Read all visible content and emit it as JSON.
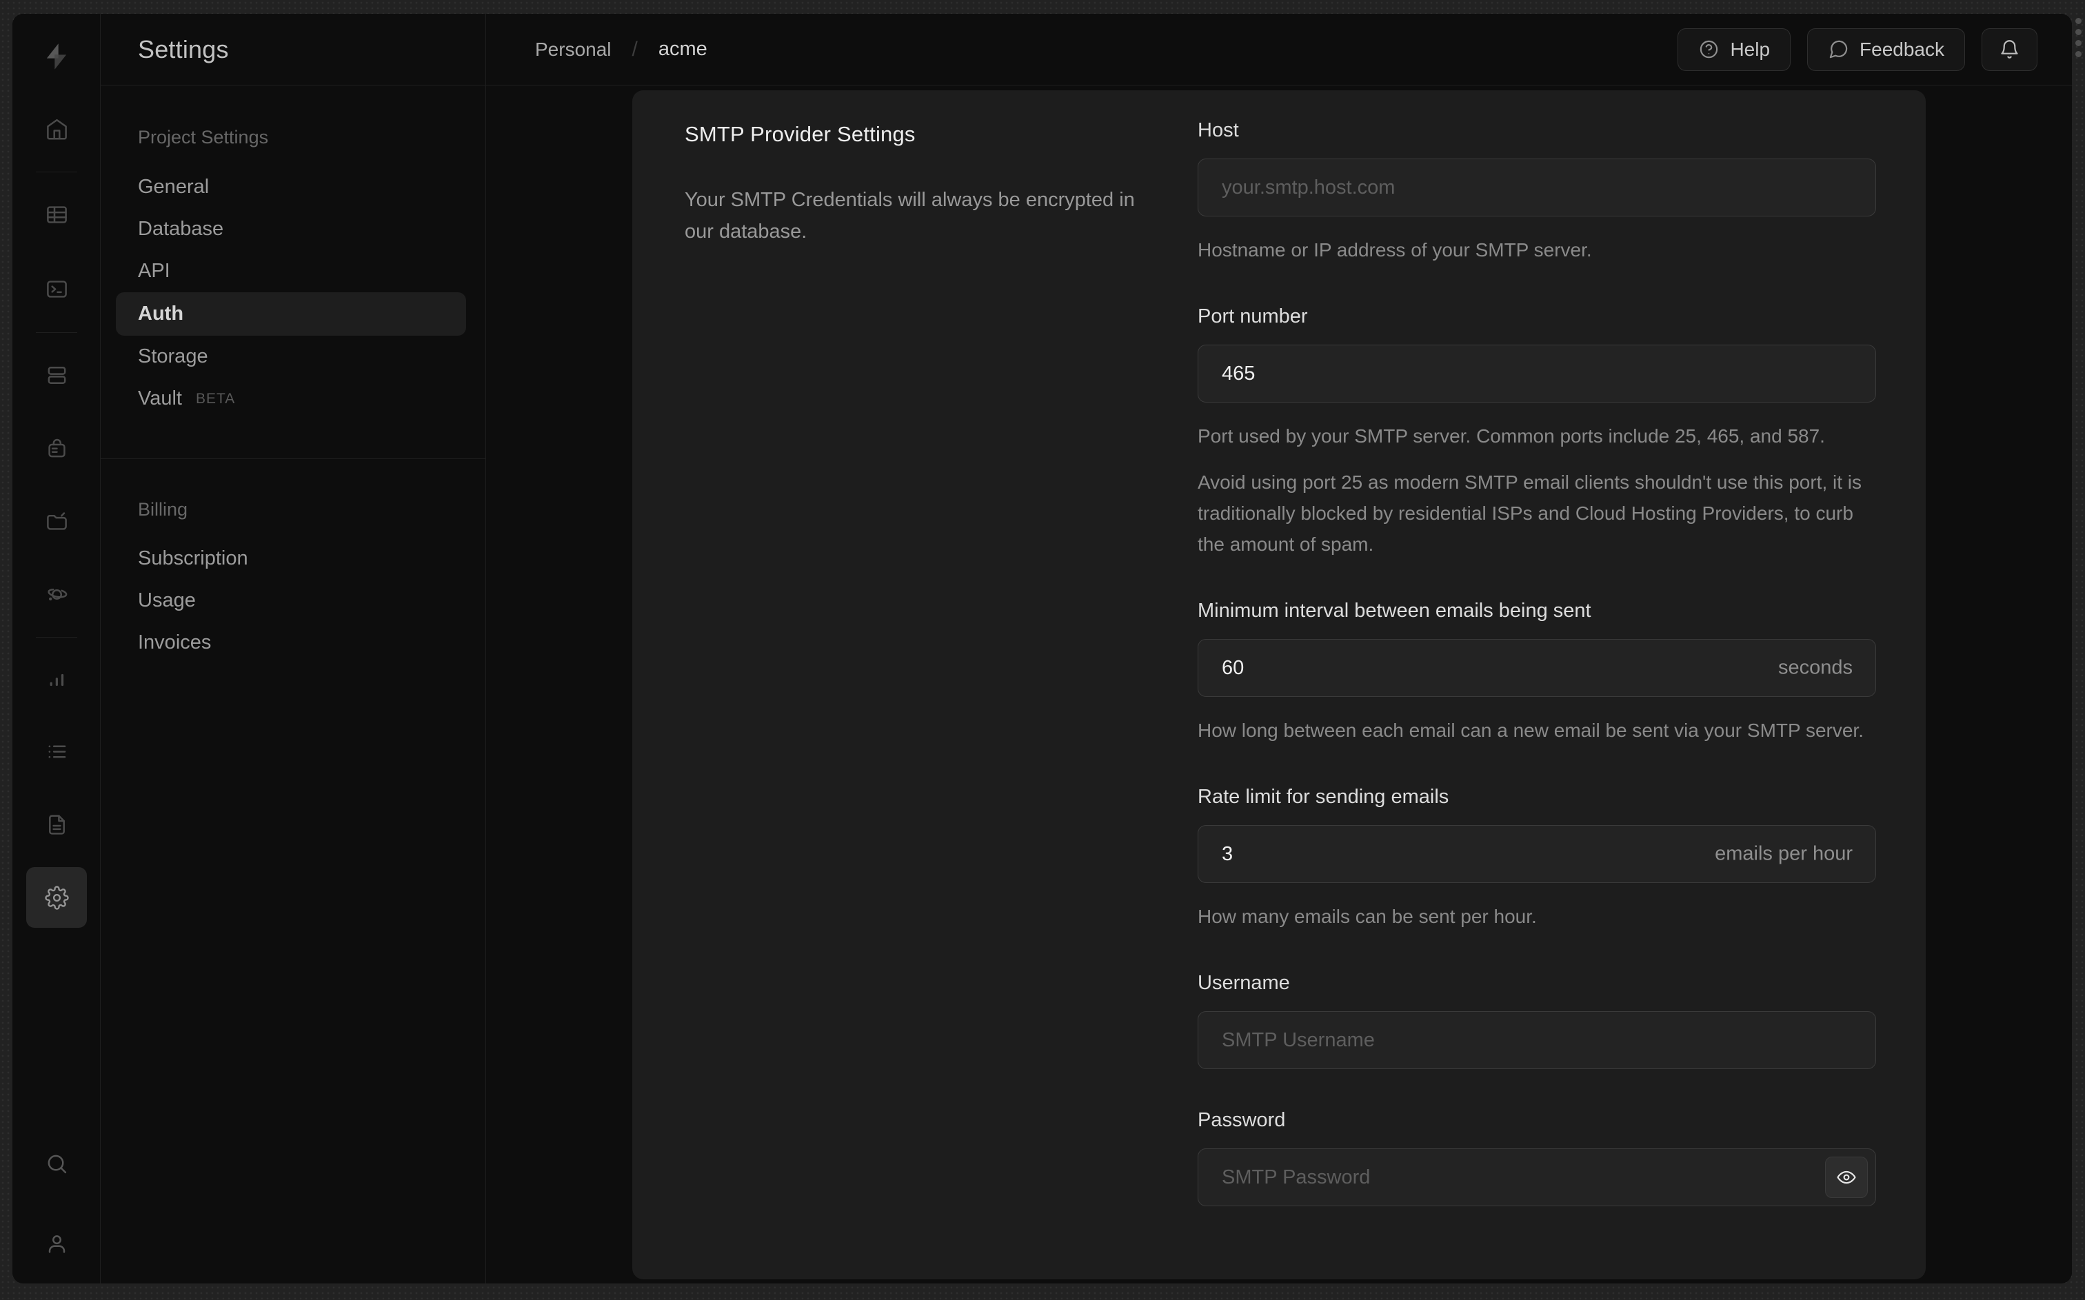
{
  "colors": {
    "frame_bg": "#222222",
    "page_bg": "#0d0d0d",
    "panel_bg": "#1d1d1d",
    "border": "#1e1e1e",
    "input_border": "#3a3a3a",
    "text_primary": "#eeeeee",
    "text_muted": "#8a8a8a"
  },
  "rail": {
    "icons": [
      "supabase-logo",
      "home",
      "table-editor",
      "sql-editor",
      "database",
      "auth",
      "storage",
      "edge-functions",
      "reports",
      "logs",
      "docs",
      "settings",
      "search",
      "user"
    ],
    "active_icon": "settings"
  },
  "sidebar": {
    "title": "Settings",
    "sections": [
      {
        "heading": "Project Settings",
        "items": [
          {
            "label": "General"
          },
          {
            "label": "Database"
          },
          {
            "label": "API"
          },
          {
            "label": "Auth",
            "active": true
          },
          {
            "label": "Storage"
          },
          {
            "label": "Vault",
            "badge": "BETA"
          }
        ]
      },
      {
        "heading": "Billing",
        "items": [
          {
            "label": "Subscription"
          },
          {
            "label": "Usage"
          },
          {
            "label": "Invoices"
          }
        ]
      }
    ]
  },
  "header": {
    "breadcrumb": {
      "org": "Personal",
      "separator": "/",
      "project": "acme"
    },
    "help_label": "Help",
    "feedback_label": "Feedback"
  },
  "panel": {
    "title": "SMTP Provider Settings",
    "description": "Your SMTP Credentials will always be encrypted in our database.",
    "fields": {
      "host": {
        "label": "Host",
        "placeholder": "your.smtp.host.com",
        "helper": "Hostname or IP address of your SMTP server."
      },
      "port": {
        "label": "Port number",
        "value": "465",
        "helper": "Port used by your SMTP server. Common ports include 25, 465, and 587.",
        "warning": "Avoid using port 25 as modern SMTP email clients shouldn't use this port, it is traditionally blocked by residential ISPs and Cloud Hosting Providers, to curb the amount of spam."
      },
      "interval": {
        "label": "Minimum interval between emails being sent",
        "value": "60",
        "suffix": "seconds",
        "helper": "How long between each email can a new email be sent via your SMTP server."
      },
      "rate": {
        "label": "Rate limit for sending emails",
        "value": "3",
        "suffix": "emails per hour",
        "helper": "How many emails can be sent per hour."
      },
      "username": {
        "label": "Username",
        "placeholder": "SMTP Username"
      },
      "password": {
        "label": "Password",
        "placeholder": "SMTP Password"
      }
    }
  }
}
